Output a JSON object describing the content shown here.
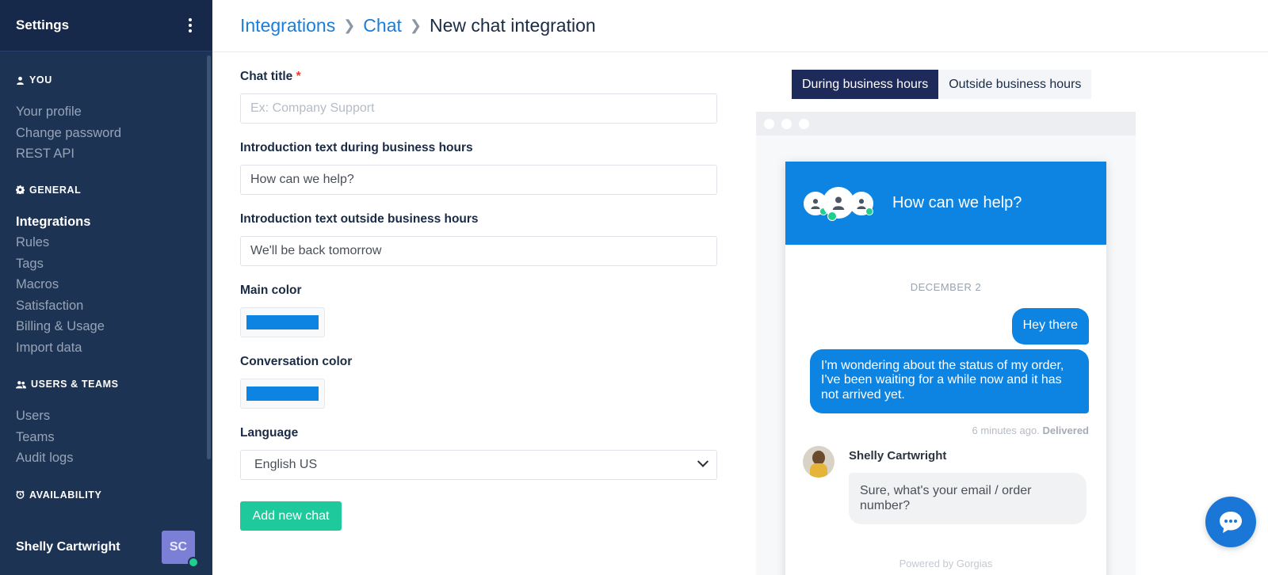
{
  "sidebar": {
    "title": "Settings",
    "sections": [
      {
        "title": "YOU",
        "icon": "user-icon",
        "items": [
          {
            "label": "Your profile",
            "active": false
          },
          {
            "label": "Change password",
            "active": false
          },
          {
            "label": "REST API",
            "active": false
          }
        ]
      },
      {
        "title": "GENERAL",
        "icon": "gear-icon",
        "items": [
          {
            "label": "Integrations",
            "active": true
          },
          {
            "label": "Rules",
            "active": false
          },
          {
            "label": "Tags",
            "active": false
          },
          {
            "label": "Macros",
            "active": false
          },
          {
            "label": "Satisfaction",
            "active": false
          },
          {
            "label": "Billing & Usage",
            "active": false
          },
          {
            "label": "Import data",
            "active": false
          }
        ]
      },
      {
        "title": "USERS & TEAMS",
        "icon": "users-icon",
        "items": [
          {
            "label": "Users",
            "active": false
          },
          {
            "label": "Teams",
            "active": false
          },
          {
            "label": "Audit logs",
            "active": false
          }
        ]
      },
      {
        "title": "AVAILABILITY",
        "icon": "clock-icon",
        "items": []
      }
    ],
    "user": {
      "name": "Shelly Cartwright",
      "initials": "SC",
      "status": "online"
    }
  },
  "breadcrumb": {
    "items": [
      "Integrations",
      "Chat"
    ],
    "current": "New chat integration"
  },
  "form": {
    "chat_title": {
      "label": "Chat title",
      "required_mark": "*",
      "value": "",
      "placeholder": "Ex: Company Support"
    },
    "intro_business": {
      "label": "Introduction text during business hours",
      "value": "How can we help?"
    },
    "intro_outside": {
      "label": "Introduction text outside business hours",
      "value": "We'll be back tomorrow"
    },
    "main_color": {
      "label": "Main color",
      "value": "#0d84e2"
    },
    "conversation_color": {
      "label": "Conversation color",
      "value": "#0d84e2"
    },
    "language": {
      "label": "Language",
      "value": "English US"
    },
    "submit_label": "Add new chat"
  },
  "preview": {
    "tabs": [
      {
        "label": "During business hours",
        "active": true
      },
      {
        "label": "Outside business hours",
        "active": false
      }
    ],
    "header_title": "How can we help?",
    "date": "DECEMBER 2",
    "messages_out": [
      "Hey there",
      "I'm wondering about the status of my order, I've been waiting for a while now and it has not arrived yet."
    ],
    "meta_time": "6 minutes ago.",
    "meta_status": "Delivered",
    "agent_name": "Shelly Cartwright",
    "agent_reply": "Sure, what's your email / order number?",
    "powered_by": "Powered by Gorgias"
  },
  "fab": {
    "icon": "chat-bubble-icon"
  }
}
